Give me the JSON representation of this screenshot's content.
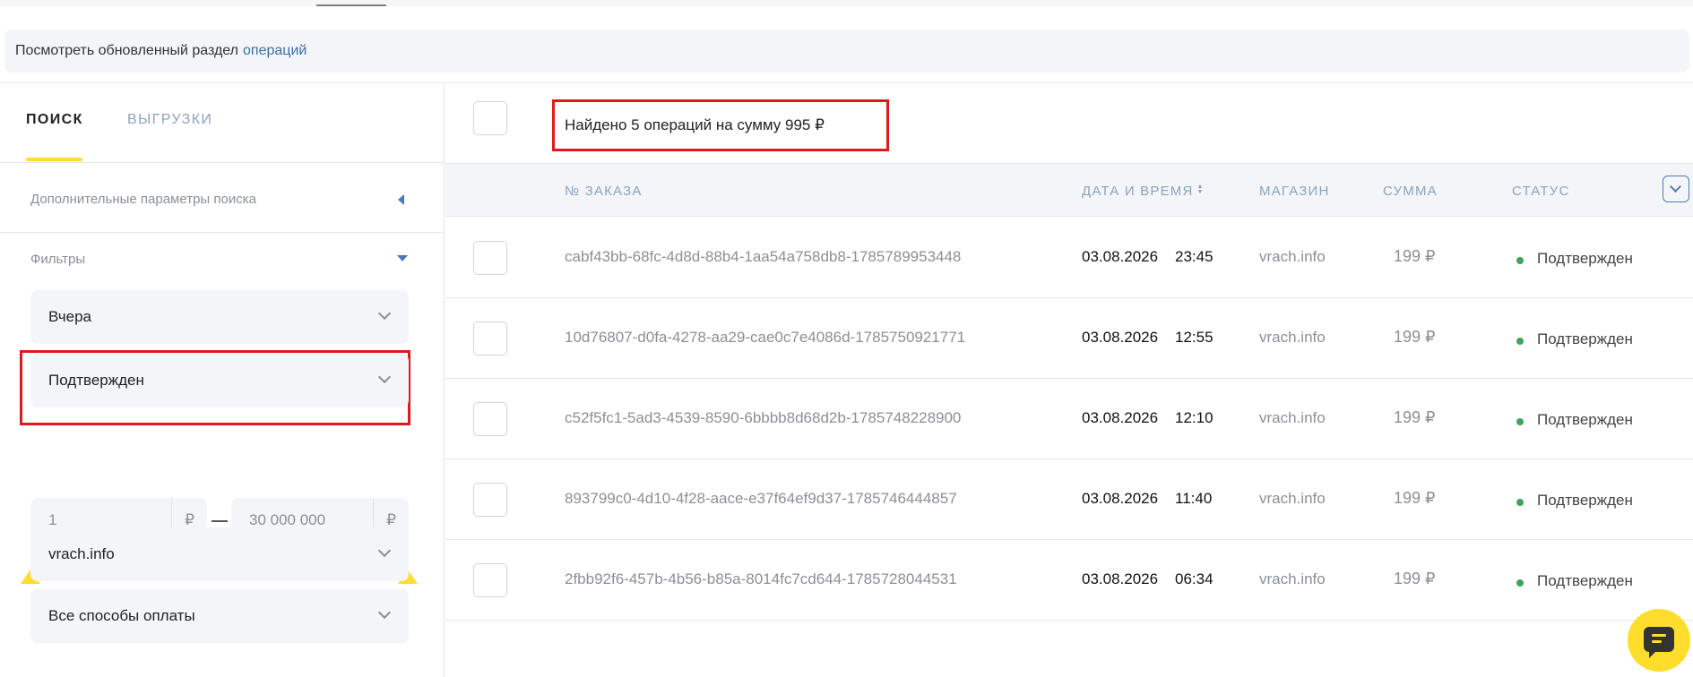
{
  "banner": {
    "text": "Посмотреть обновленный раздел",
    "link": "операций"
  },
  "left_panel": {
    "tabs": [
      {
        "label": "ПОИСК",
        "active": true
      },
      {
        "label": "ВЫГРУЗКИ",
        "active": false
      }
    ],
    "advanced_label": "Дополнительные параметры поиска",
    "filters_label": "Фильтры",
    "period_select": "Вчера",
    "status_select": "Подтвержден",
    "amount_from": "1",
    "amount_to": "30 000 000",
    "currency": "₽",
    "shop_select": "vrach.info",
    "payment_select": "Все способы оплаты"
  },
  "results": {
    "summary": "Найдено 5 операций на сумму 995 ₽",
    "columns": {
      "order": "№ ЗАКАЗА",
      "datetime": "ДАТА И ВРЕМЯ",
      "shop": "МАГАЗИН",
      "sum": "СУММА",
      "status": "СТАТУС"
    },
    "rows": [
      {
        "order": "cabf43bb-68fc-4d8d-88b4-1aa54a758db8-1785789953448",
        "date": "03.08.2026",
        "time": "23:45",
        "shop": "vrach.info",
        "sum": "199 ₽",
        "status": "Подтвержден"
      },
      {
        "order": "10d76807-d0fa-4278-aa29-cae0c7e4086d-1785750921771",
        "date": "03.08.2026",
        "time": "12:55",
        "shop": "vrach.info",
        "sum": "199 ₽",
        "status": "Подтвержден"
      },
      {
        "order": "c52f5fc1-5ad3-4539-8590-6bbbb8d68d2b-1785748228900",
        "date": "03.08.2026",
        "time": "12:10",
        "shop": "vrach.info",
        "sum": "199 ₽",
        "status": "Подтвержден"
      },
      {
        "order": "893799c0-4d10-4f28-aace-e37f64ef9d37-1785746444857",
        "date": "03.08.2026",
        "time": "11:40",
        "shop": "vrach.info",
        "sum": "199 ₽",
        "status": "Подтвержден"
      },
      {
        "order": "2fbb92f6-457b-4b56-b85a-8014fc7cd644-1785728044531",
        "date": "03.08.2026",
        "time": "06:34",
        "shop": "vrach.info",
        "sum": "199 ₽",
        "status": "Подтвержден"
      }
    ]
  },
  "icons": {
    "chat": "chat-icon",
    "sort": "sort-icon",
    "dropdown": "chevron-down-icon"
  },
  "colors": {
    "accent": "#ffdd2d",
    "link": "#3b6eab",
    "highlight": "#e01919",
    "status_ok": "#3ba55c"
  }
}
